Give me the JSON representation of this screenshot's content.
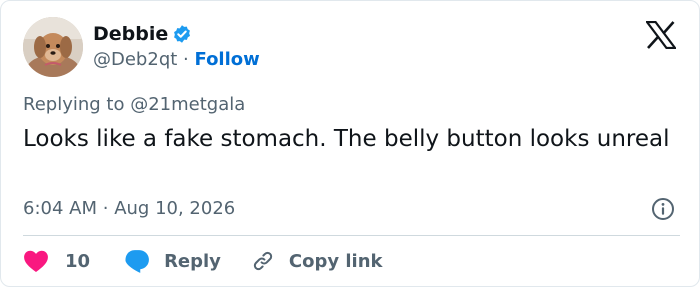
{
  "author": {
    "name": "Debbie",
    "handle": "@Deb2qt",
    "separator": "·",
    "follow_label": "Follow",
    "avatar_icon": "dog-avatar",
    "verified_icon": "verified-badge-icon"
  },
  "platform_logo": "x-logo-icon",
  "tweet": {
    "replying_to": "Replying to @21metgala",
    "text": "Looks like a fake stomach. The belly button looks unreal",
    "time": "6:04 AM",
    "date_separator": "·",
    "date": "Aug 10, 2026"
  },
  "actions": {
    "like_count": "10",
    "reply_label": "Reply",
    "copy_label": "Copy link"
  },
  "colors": {
    "accent_blue": "#1d9bf0",
    "follow_blue": "#006fd6",
    "like_red": "#f91880",
    "text_secondary": "#536471",
    "text_primary": "#0f1419"
  }
}
